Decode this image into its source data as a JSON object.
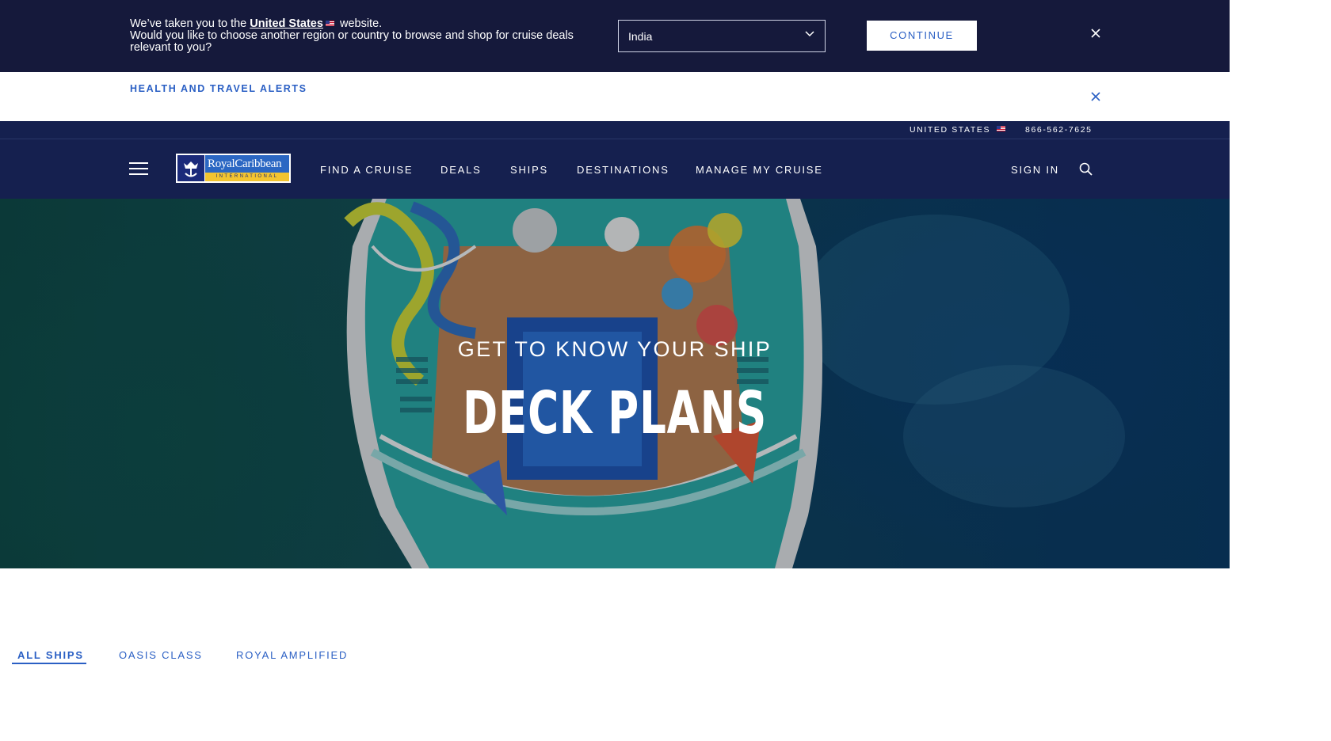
{
  "region_banner": {
    "line1_prefix": "We’ve taken you to the",
    "line1_link": "United States",
    "line1_suffix": "website.",
    "line2": "Would you like to choose another region or country to browse and shop for cruise deals relevant to you?",
    "select_value": "India",
    "continue_label": "CONTINUE"
  },
  "alert_bar": {
    "link_label": "HEALTH AND TRAVEL ALERTS"
  },
  "utility_bar": {
    "country": "UNITED STATES",
    "phone": "866-562-7625"
  },
  "logo": {
    "wordmark": "RoyalCaribbean",
    "sub": "INTERNATIONAL"
  },
  "nav": {
    "items": [
      "FIND A CRUISE",
      "DEALS",
      "SHIPS",
      "DESTINATIONS",
      "MANAGE MY CRUISE"
    ],
    "sign_in": "SIGN IN"
  },
  "hero": {
    "kicker": "GET TO KNOW YOUR SHIP",
    "title": "DECK PLANS"
  },
  "tabs": {
    "items": [
      "ALL SHIPS",
      "OASIS CLASS",
      "ROYAL AMPLIFIED"
    ],
    "active": "ALL SHIPS"
  },
  "colors": {
    "banner_bg": "#15193b",
    "nav_bg": "#15204f",
    "link_blue": "#2a5fc4",
    "logo_blue": "#2b67c3",
    "logo_yellow": "#f2c430"
  },
  "icons": [
    "chevron-down-icon",
    "close-icon",
    "us-flag-icon",
    "hamburger-icon",
    "search-icon",
    "crown-anchor-icon"
  ]
}
